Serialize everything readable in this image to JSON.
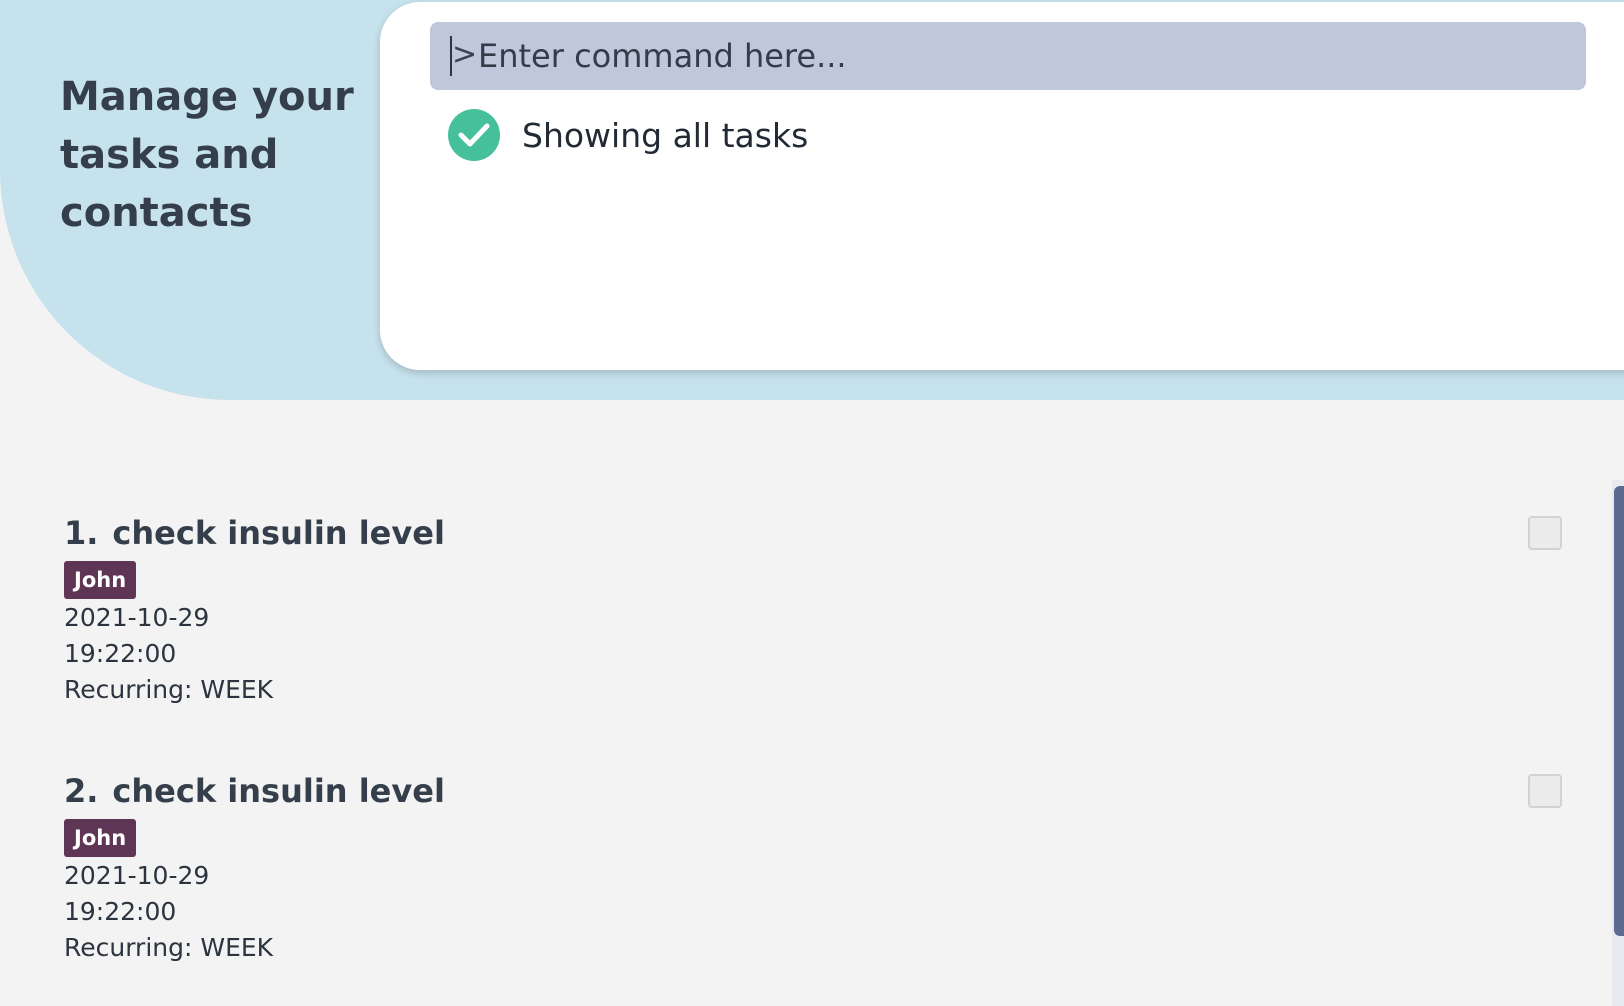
{
  "header": {
    "tagline_line1": "Manage your",
    "tagline_line2": "tasks and",
    "tagline_line3": "contacts"
  },
  "command": {
    "placeholder": "Enter command here...",
    "prompt_glyph": ">"
  },
  "result": {
    "message": "Showing all tasks",
    "icon": "check-circle-icon"
  },
  "tasks": [
    {
      "index": "1.",
      "title": "check insulin level",
      "tag": "John",
      "date": "2021-10-29",
      "time": "19:22:00",
      "recurring": "Recurring: WEEK",
      "done": false
    },
    {
      "index": "2.",
      "title": "check insulin level",
      "tag": "John",
      "date": "2021-10-29",
      "time": "19:22:00",
      "recurring": "Recurring: WEEK",
      "done": false
    }
  ],
  "colors": {
    "hero_bg": "#c6e2ec",
    "command_bg": "#bfc8da",
    "success": "#46c09a",
    "tag_bg": "#5e3554",
    "scrollbar": "#5c6a90"
  }
}
